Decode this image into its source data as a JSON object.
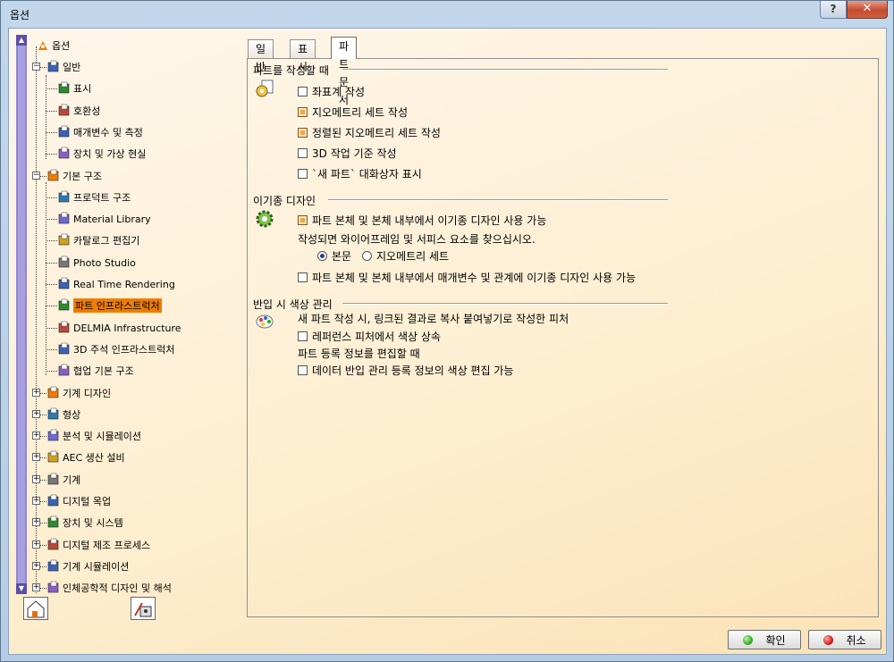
{
  "window": {
    "title": "옵션",
    "help_label": "?",
    "close_label": "✕"
  },
  "tree": {
    "root": "옵션",
    "nodes": [
      {
        "label": "일반",
        "level": 1
      },
      {
        "label": "표시",
        "level": 2
      },
      {
        "label": "호환성",
        "level": 2
      },
      {
        "label": "매개변수 및 측정",
        "level": 2
      },
      {
        "label": "장치 및 가상 현실",
        "level": 2
      },
      {
        "label": "기본 구조",
        "level": 1
      },
      {
        "label": "프로덕트 구조",
        "level": 2
      },
      {
        "label": "Material Library",
        "level": 2
      },
      {
        "label": "카탈로그 편집기",
        "level": 2
      },
      {
        "label": "Photo Studio",
        "level": 2
      },
      {
        "label": "Real Time Rendering",
        "level": 2
      },
      {
        "label": "파트 인프라스트럭처",
        "level": 2,
        "selected": true
      },
      {
        "label": "DELMIA Infrastructure",
        "level": 2
      },
      {
        "label": "3D 주석 인프라스트럭처",
        "level": 2
      },
      {
        "label": "협업 기본 구조",
        "level": 2
      },
      {
        "label": "기계 디자인",
        "level": 1
      },
      {
        "label": "형상",
        "level": 1
      },
      {
        "label": "분석 및 시뮬레이션",
        "level": 1
      },
      {
        "label": "AEC 생산 설비",
        "level": 1
      },
      {
        "label": "기계",
        "level": 1
      },
      {
        "label": "디지털 목업",
        "level": 1
      },
      {
        "label": "장치 및 시스템",
        "level": 1
      },
      {
        "label": "디지털 제조 프로세스",
        "level": 1
      },
      {
        "label": "기계 시뮬레이션",
        "level": 1
      },
      {
        "label": "인체공학적 디자인 및 해석",
        "level": 1
      }
    ]
  },
  "tabs": [
    "일반",
    "표시",
    "파트 문서"
  ],
  "active_tab": 2,
  "groups": {
    "create": {
      "title": "파트를 작성할 때",
      "items": [
        {
          "label": "좌표계 작성",
          "checked": false
        },
        {
          "label": "지오메트리 세트 작성",
          "checked": true
        },
        {
          "label": "정렬된 지오메트리 세트 작성",
          "checked": true
        },
        {
          "label": "3D 작업 기준 작성",
          "checked": false
        },
        {
          "label": "`새 파트` 대화상자 표시",
          "checked": false
        }
      ]
    },
    "hybrid": {
      "title": "이기종 디자인",
      "item1": "파트 본체 및 본체 내부에서 이기종 디자인 사용 가능",
      "note": "작성되면 와이어프레임 및 서피스 요소를 찾으십시오.",
      "radio1": "본문",
      "radio2": "지오메트리 세트",
      "item2": "파트 본체 및 본체 내부에서 매개변수 및 관계에 이기종 디자인 사용 가능"
    },
    "color": {
      "title": "반입 시 색상 관리",
      "text1": "새 파트 작성 시, 링크된 결과로 복사 붙여넣기로 작성한 피처",
      "item1": "레퍼런스 피처에서 색상 상속",
      "text2": "파트 등록 정보를 편집할 때",
      "item2": "데이터 반입 관리 등록 정보의 색상 편집 가능"
    }
  },
  "buttons": {
    "ok": "확인",
    "cancel": "취소"
  },
  "colors": {
    "selection": "#f07c00",
    "checked": "#f3a64a",
    "ok_dot": "#3cae2c",
    "cancel_dot": "#d8201f"
  }
}
